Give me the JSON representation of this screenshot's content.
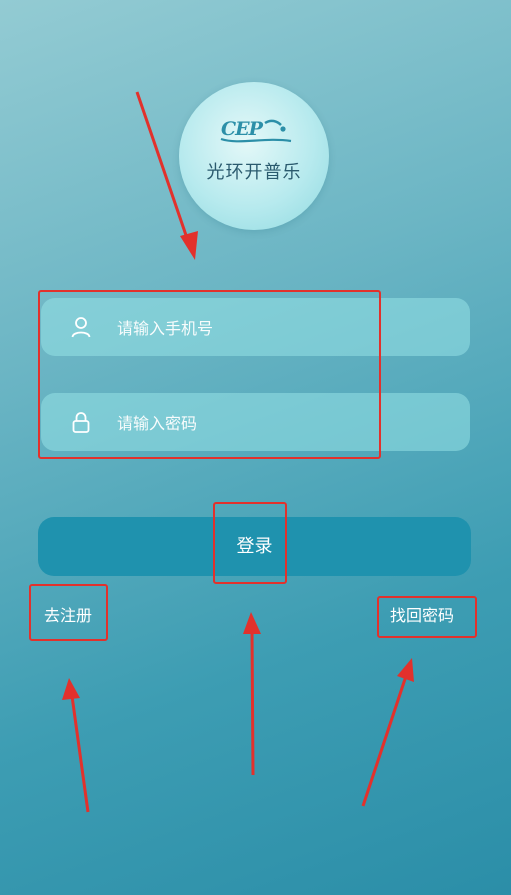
{
  "logo": {
    "mark_text": "CEP",
    "brand_name": "光环开普乐"
  },
  "form": {
    "phone_placeholder": "请输入手机号",
    "password_placeholder": "请输入密码",
    "login_label": "登录"
  },
  "links": {
    "register": "去注册",
    "forgot_password": "找回密码"
  },
  "colors": {
    "annotation": "#e2312c",
    "login_button": "#1f92ae"
  },
  "icons": {
    "phone_field": "user-icon",
    "password_field": "lock-icon"
  }
}
